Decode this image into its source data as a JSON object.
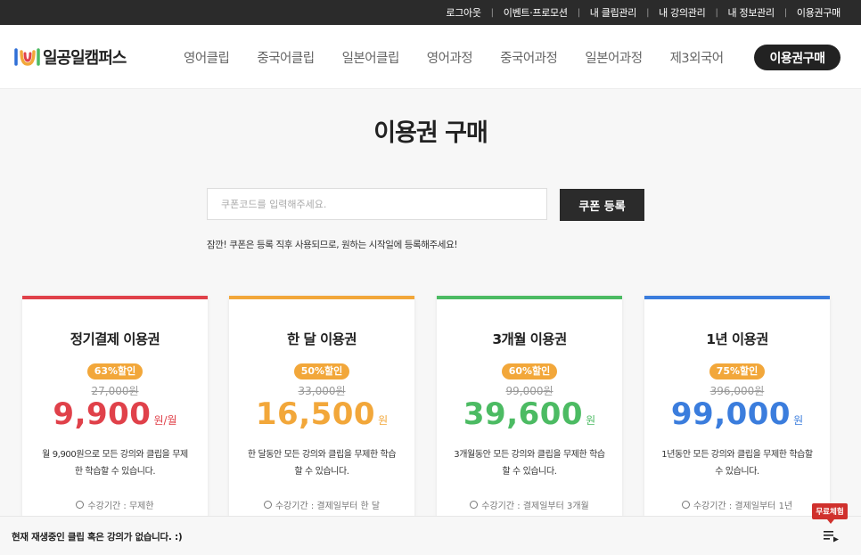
{
  "topbar": {
    "links": [
      "로그아웃",
      "이벤트·프로모션",
      "내 클립관리",
      "내 강의관리",
      "내 정보관리",
      "이용권구매"
    ]
  },
  "header": {
    "logo_text": "일공일캠퍼스",
    "nav": [
      "영어클립",
      "중국어클립",
      "일본어클립",
      "영어과정",
      "중국어과정",
      "일본어과정",
      "제3외국어"
    ],
    "buy_button": "이용권구매"
  },
  "main": {
    "title": "이용권 구매",
    "coupon": {
      "placeholder": "쿠폰코드를 입력해주세요.",
      "button": "쿠폰 등록",
      "note": "잠깐! 쿠폰은 등록 직후 사용되므로, 원하는 시작일에 등록해주세요!"
    }
  },
  "plans": [
    {
      "title": "정기결제 이용권",
      "discount": "63%할인",
      "original_price": "27,000원",
      "price": "9,900",
      "unit": "원/월",
      "color": "#e0414a",
      "desc": "월 9,900원으로 모든 강의와 클립을 무제한 학습할 수 있습니다.",
      "period": "수강기간 : 무제한"
    },
    {
      "title": "한 달 이용권",
      "discount": "50%할인",
      "original_price": "33,000원",
      "price": "16,500",
      "unit": "원",
      "color": "#f2a73a",
      "desc": "한 달동안 모든 강의와 클립을 무제한 학습할 수 있습니다.",
      "period": "수강기간 : 결제일부터 한 달"
    },
    {
      "title": "3개월 이용권",
      "discount": "60%할인",
      "original_price": "99,000원",
      "price": "39,600",
      "unit": "원",
      "color": "#4cbb63",
      "desc": "3개월동안 모든 강의와 클립을 무제한 학습할 수 있습니다.",
      "period": "수강기간 : 결제일부터 3개월"
    },
    {
      "title": "1년 이용권",
      "discount": "75%할인",
      "original_price": "396,000원",
      "price": "99,000",
      "unit": "원",
      "color": "#3b7ddd",
      "desc": "1년동안 모든 강의와 클립을 무제한 학습할 수 있습니다.",
      "period": "수강기간 : 결제일부터 1년"
    }
  ],
  "player": {
    "status": "현재 재생중인 클립 혹은 강의가 없습니다. :)",
    "trial_badge": "무료체험",
    "playlist_icon": "playlist-play-icon"
  }
}
